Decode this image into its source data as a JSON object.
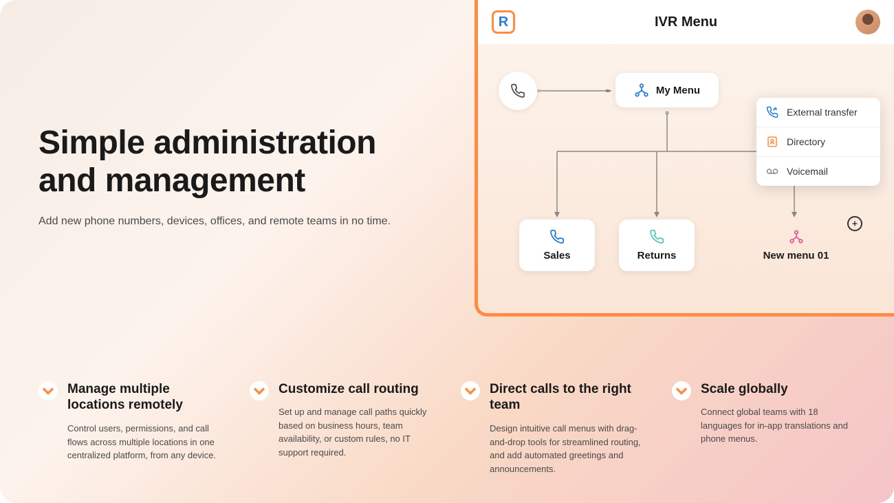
{
  "hero": {
    "title": "Simple administration and management",
    "subtitle": "Add new phone numbers, devices, offices, and remote teams in no time."
  },
  "ivr": {
    "title": "IVR Menu",
    "nodes": {
      "mymenu": "My Menu",
      "sales": "Sales",
      "returns": "Returns",
      "newmenu": "New menu 01"
    },
    "popover": {
      "external_transfer": "External transfer",
      "directory": "Directory",
      "voicemail": "Voicemail"
    }
  },
  "features": [
    {
      "title": "Manage multiple locations remotely",
      "desc": "Control users, permissions, and call flows across multiple locations in one centralized platform, from any device."
    },
    {
      "title": "Customize call routing",
      "desc": "Set up and manage call paths quickly based on business hours, team availability, or custom rules, no IT support required."
    },
    {
      "title": "Direct calls to the right team",
      "desc": "Design intuitive call menus with drag-and-drop tools for streamlined routing, and add automated greetings and announcements."
    },
    {
      "title": "Scale globally",
      "desc": "Connect global teams with 18 languages for in-app translations and phone menus."
    }
  ]
}
